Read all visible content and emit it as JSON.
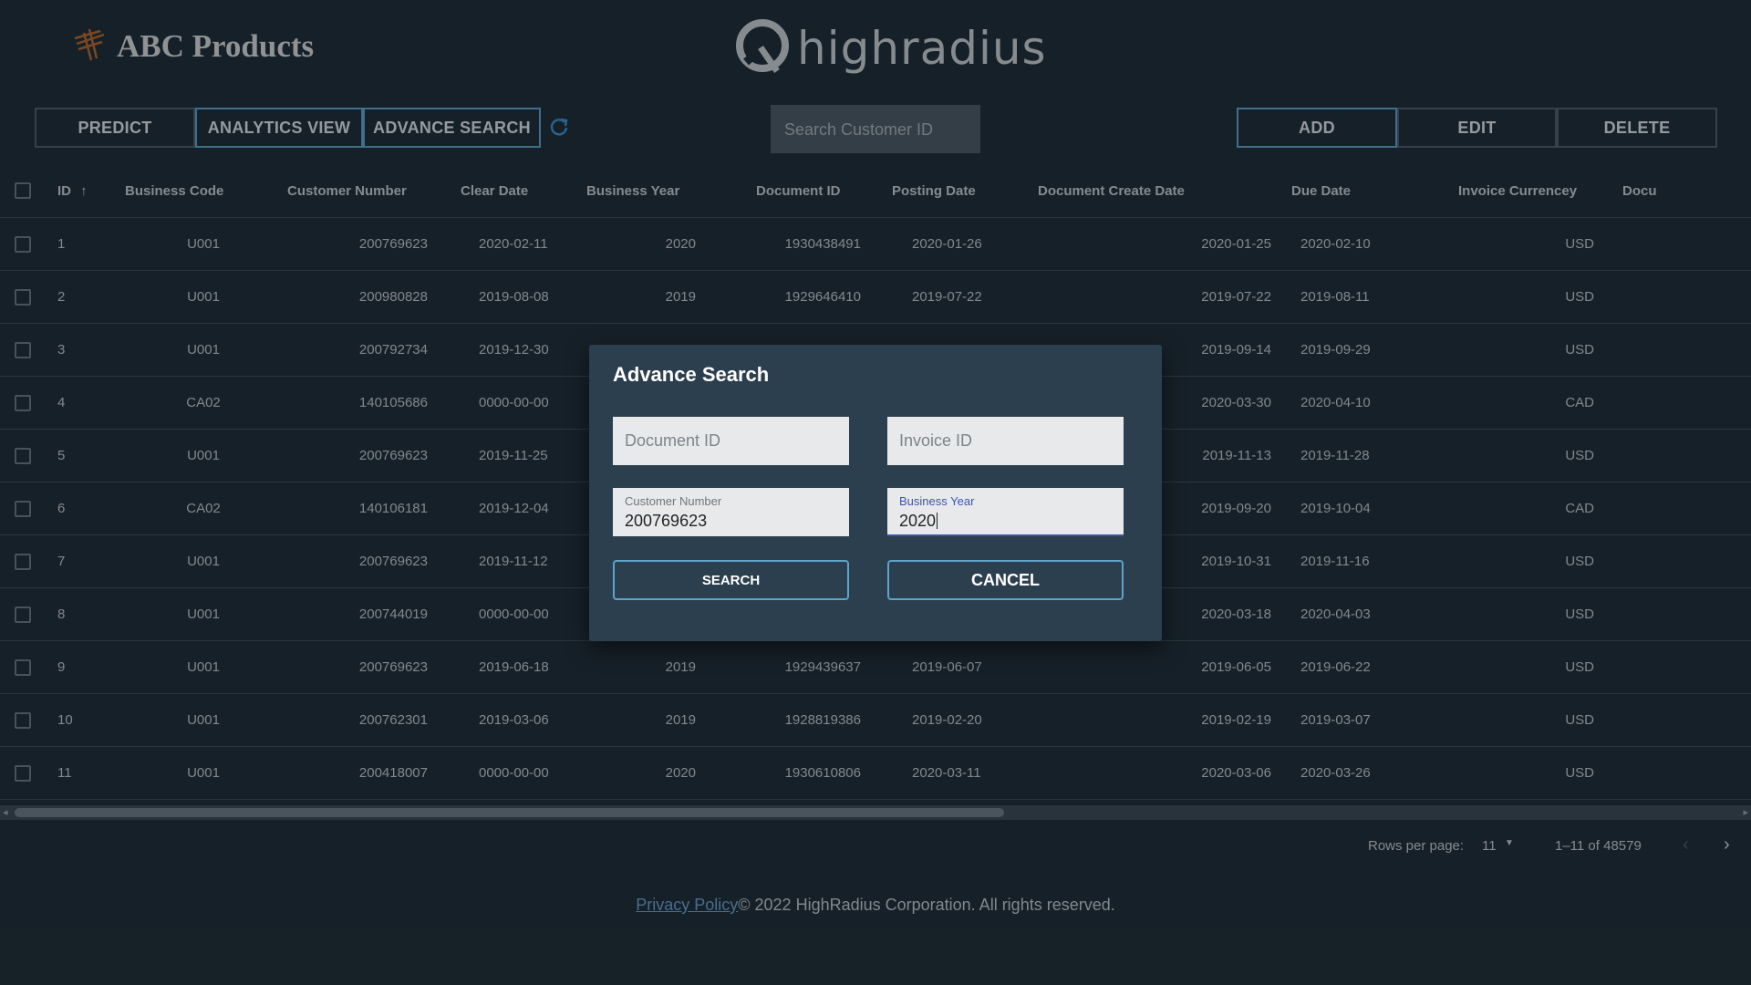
{
  "brand": {
    "name": "ABC Products",
    "company": "highradius"
  },
  "toolbar": {
    "predict": "PREDICT",
    "analytics": "ANALYTICS VIEW",
    "advance": "ADVANCE SEARCH",
    "search_placeholder": "Search Customer ID",
    "add": "ADD",
    "edit": "EDIT",
    "delete": "DELETE"
  },
  "table": {
    "columns": [
      "ID",
      "Business Code",
      "Customer Number",
      "Clear Date",
      "Business Year",
      "Document ID",
      "Posting Date",
      "Document Create Date",
      "Due Date",
      "Invoice Currencey",
      "Docu"
    ],
    "rows": [
      {
        "id": "1",
        "code": "U001",
        "cust": "200769623",
        "clear": "2020-02-11",
        "year": "2020",
        "doc": "1930438491",
        "post": "2020-01-26",
        "create": "2020-01-25",
        "due": "2020-02-10",
        "cur": "USD"
      },
      {
        "id": "2",
        "code": "U001",
        "cust": "200980828",
        "clear": "2019-08-08",
        "year": "2019",
        "doc": "1929646410",
        "post": "2019-07-22",
        "create": "2019-07-22",
        "due": "2019-08-11",
        "cur": "USD"
      },
      {
        "id": "3",
        "code": "U001",
        "cust": "200792734",
        "clear": "2019-12-30",
        "year": "",
        "doc": "",
        "post": "",
        "create": "2019-09-14",
        "due": "2019-09-29",
        "cur": "USD"
      },
      {
        "id": "4",
        "code": "CA02",
        "cust": "140105686",
        "clear": "0000-00-00",
        "year": "",
        "doc": "",
        "post": "",
        "create": "2020-03-30",
        "due": "2020-04-10",
        "cur": "CAD"
      },
      {
        "id": "5",
        "code": "U001",
        "cust": "200769623",
        "clear": "2019-11-25",
        "year": "",
        "doc": "",
        "post": "",
        "create": "2019-11-13",
        "due": "2019-11-28",
        "cur": "USD"
      },
      {
        "id": "6",
        "code": "CA02",
        "cust": "140106181",
        "clear": "2019-12-04",
        "year": "",
        "doc": "",
        "post": "",
        "create": "2019-09-20",
        "due": "2019-10-04",
        "cur": "CAD"
      },
      {
        "id": "7",
        "code": "U001",
        "cust": "200769623",
        "clear": "2019-11-12",
        "year": "",
        "doc": "",
        "post": "",
        "create": "2019-10-31",
        "due": "2019-11-16",
        "cur": "USD"
      },
      {
        "id": "8",
        "code": "U001",
        "cust": "200744019",
        "clear": "0000-00-00",
        "year": "",
        "doc": "",
        "post": "",
        "create": "2020-03-18",
        "due": "2020-04-03",
        "cur": "USD"
      },
      {
        "id": "9",
        "code": "U001",
        "cust": "200769623",
        "clear": "2019-06-18",
        "year": "2019",
        "doc": "1929439637",
        "post": "2019-06-07",
        "create": "2019-06-05",
        "due": "2019-06-22",
        "cur": "USD"
      },
      {
        "id": "10",
        "code": "U001",
        "cust": "200762301",
        "clear": "2019-03-06",
        "year": "2019",
        "doc": "1928819386",
        "post": "2019-02-20",
        "create": "2019-02-19",
        "due": "2019-03-07",
        "cur": "USD"
      },
      {
        "id": "11",
        "code": "U001",
        "cust": "200418007",
        "clear": "0000-00-00",
        "year": "2020",
        "doc": "1930610806",
        "post": "2020-03-11",
        "create": "2020-03-06",
        "due": "2020-03-26",
        "cur": "USD"
      }
    ]
  },
  "pagination": {
    "label": "Rows per page:",
    "rows": "11",
    "info": "1–11 of 48579"
  },
  "footer": {
    "link": "Privacy Policy",
    "text": "© 2022 HighRadius Corporation. All rights reserved."
  },
  "dialog": {
    "title": "Advance Search",
    "document_id_placeholder": "Document ID",
    "invoice_id_placeholder": "Invoice ID",
    "customer_label": "Customer Number",
    "customer_value": "200769623",
    "year_label": "Business Year",
    "year_value": "2020",
    "search": "SEARCH",
    "cancel": "CANCEL"
  },
  "colors": {
    "background": "#1e2a33",
    "accent": "#5ea3c9",
    "dialog": "#2c3f4e"
  },
  "icons": [
    "brand-logo-icon",
    "highradius-logo-icon",
    "refresh-icon",
    "sort-up-icon",
    "chevron-left-icon",
    "chevron-right-icon",
    "dropdown-caret-icon"
  ]
}
